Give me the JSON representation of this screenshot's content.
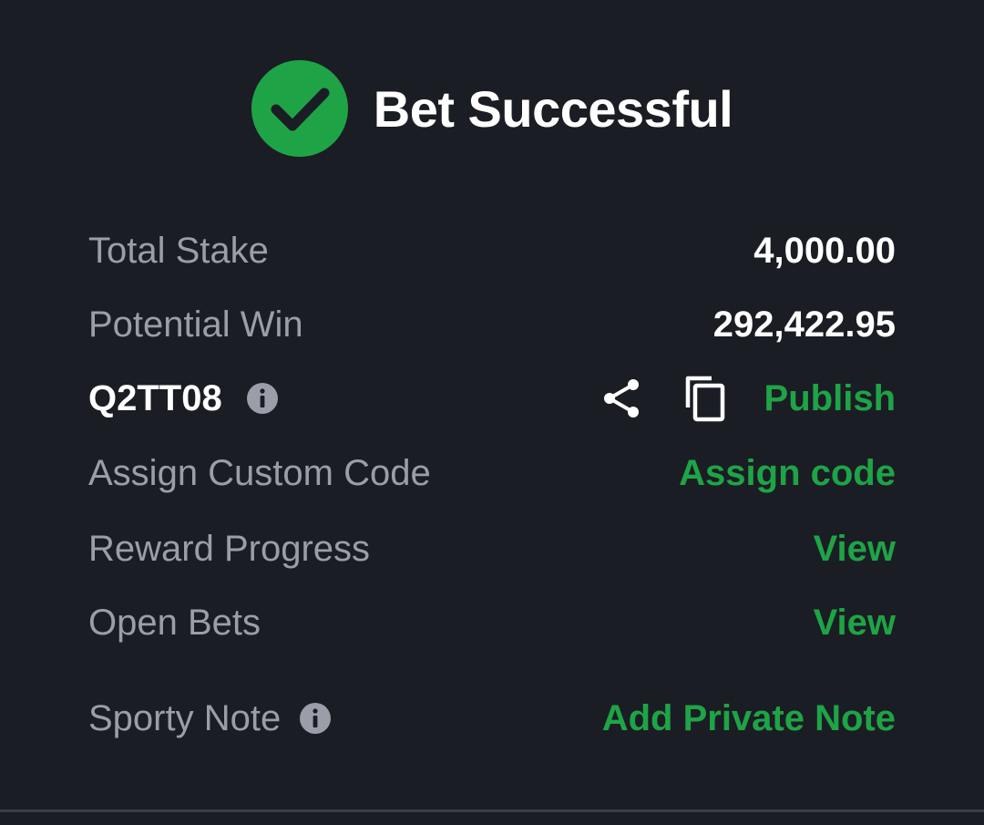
{
  "header": {
    "title": "Bet Successful",
    "icon": "check-circle-icon",
    "icon_color": "#1ea446"
  },
  "summary": {
    "total_stake_label": "Total Stake",
    "total_stake_value": "4,000.00",
    "potential_win_label": "Potential Win",
    "potential_win_value": "292,422.95"
  },
  "booking": {
    "code": "Q2TT08",
    "publish_label": "Publish"
  },
  "actions": {
    "assign_label": "Assign Custom Code",
    "assign_action": "Assign code",
    "reward_label": "Reward Progress",
    "reward_action": "View",
    "open_bets_label": "Open Bets",
    "open_bets_action": "View",
    "note_label": "Sporty Note",
    "note_action": "Add Private Note"
  },
  "colors": {
    "background": "#1b1d24",
    "accent": "#1ea446",
    "muted_text": "#9b9ea8"
  }
}
